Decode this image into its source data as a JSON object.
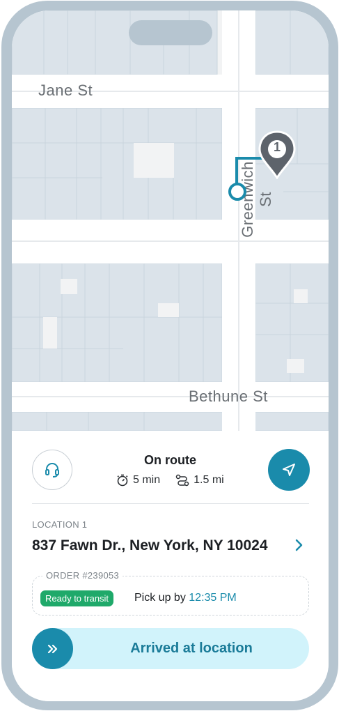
{
  "map": {
    "streets": [
      "Jane St",
      "Greenwich St",
      "Bethune St"
    ],
    "pin_number": "1"
  },
  "status": {
    "title": "On route",
    "eta": "5 min",
    "distance": "1.5 mi"
  },
  "location": {
    "label": "LOCATION 1",
    "address": "837 Fawn Dr., New York, NY 10024"
  },
  "order": {
    "label": "ORDER #239053",
    "badge": "Ready to transit",
    "pickup_prefix": "Pick up by",
    "pickup_time": "12:35 PM"
  },
  "action": {
    "slider_label": "Arrived at location"
  },
  "colors": {
    "accent": "#1a8bab",
    "badge_green": "#1fa96a",
    "slider_bg": "#d1f3fb"
  },
  "icons": [
    "headset-icon",
    "navigation-arrow-icon",
    "timer-icon",
    "route-icon",
    "chevron-right-icon",
    "double-chevron-right-icon",
    "map-pin-icon",
    "current-location-icon"
  ]
}
